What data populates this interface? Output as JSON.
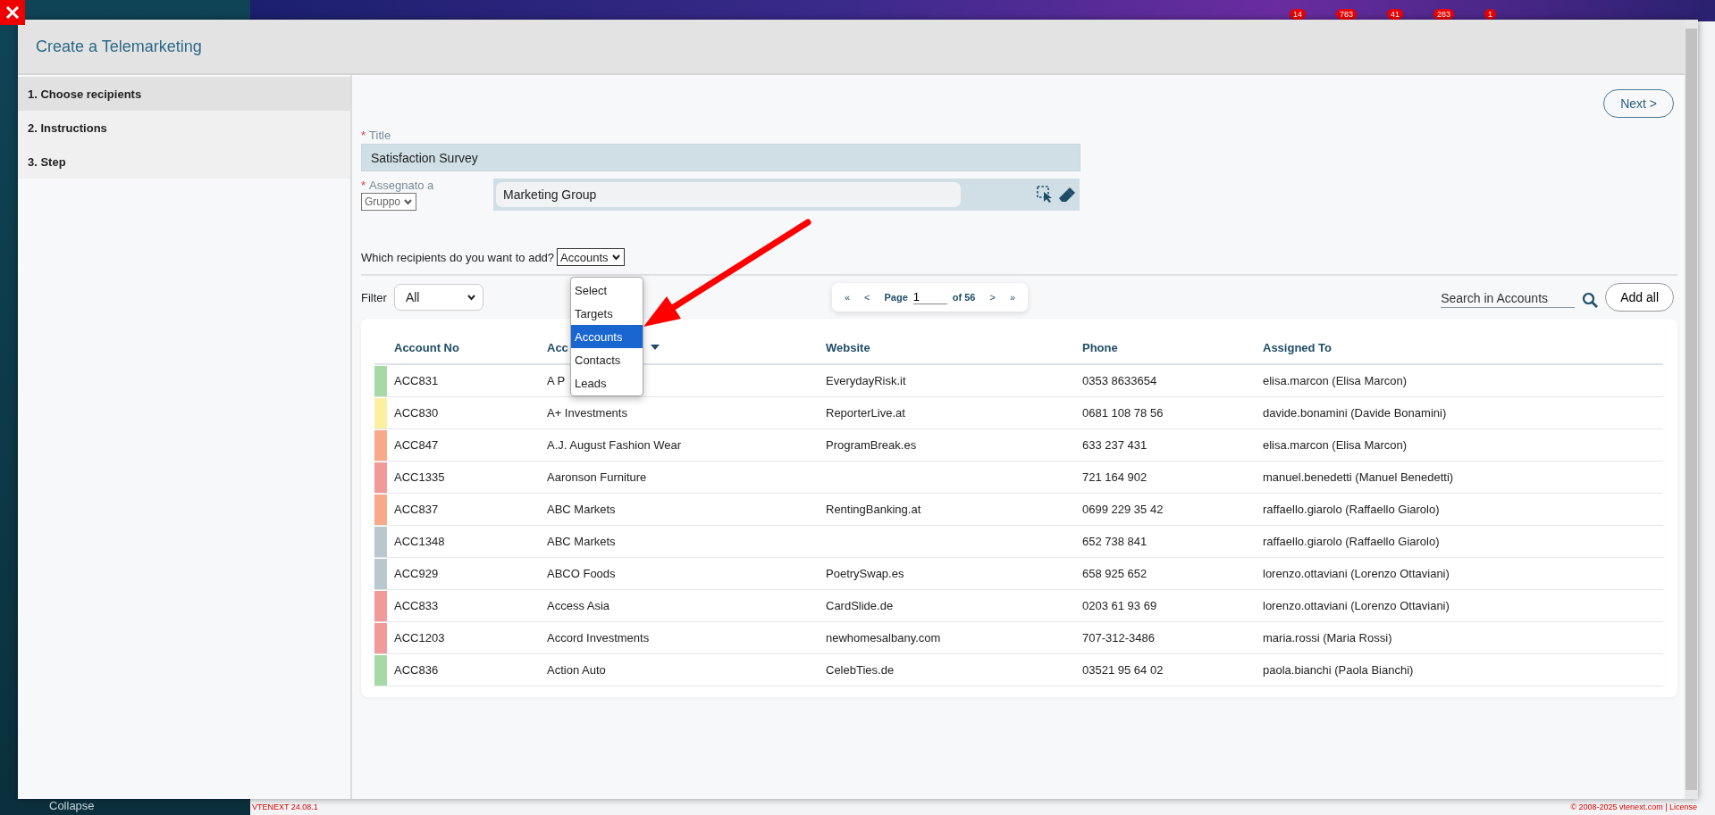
{
  "background_app": {
    "notification_badges": [
      "14",
      "783",
      "41",
      "283",
      "1"
    ],
    "collapse_label": "Collapse",
    "version": "VTENEXT 24.08.1",
    "copyright": "© 2008-2025 vtenext.com | License"
  },
  "window": {
    "title": "Create a Telemarketing"
  },
  "steps": [
    {
      "label": "1. Choose recipients",
      "selected": true
    },
    {
      "label": "2. Instructions",
      "selected": false
    },
    {
      "label": "3. Step",
      "selected": false
    }
  ],
  "next_button": "Next >",
  "form": {
    "title": {
      "required_mark": "*",
      "label": "Title",
      "value": "Satisfaction Survey"
    },
    "assigned_to": {
      "required_mark": "*",
      "label": "Assegnato a",
      "type_select": "Gruppo",
      "value": "Marketing Group"
    }
  },
  "recipients": {
    "question": "Which recipients do you want to add?",
    "value": "Accounts",
    "options": [
      {
        "label": "Select",
        "selected": false
      },
      {
        "label": "Targets",
        "selected": false
      },
      {
        "label": "Accounts",
        "selected": true
      },
      {
        "label": "Contacts",
        "selected": false
      },
      {
        "label": "Leads",
        "selected": false
      }
    ]
  },
  "filter": {
    "label": "Filter",
    "value": "All"
  },
  "pagination": {
    "first": "«",
    "prev": "<",
    "page_label": "Page",
    "page": "1",
    "of": "of 56",
    "next": ">",
    "last": "»"
  },
  "search": {
    "placeholder": "Search in Accounts"
  },
  "add_all_button": "Add all",
  "table": {
    "columns": [
      {
        "label": "Account No",
        "sorted": false
      },
      {
        "label": "Acc",
        "sorted": true
      },
      {
        "label": "Website",
        "sorted": false
      },
      {
        "label": "Phone",
        "sorted": false
      },
      {
        "label": "Assigned To",
        "sorted": false
      }
    ],
    "rows": [
      {
        "color": "#a6d9a6",
        "account_no": "ACC831",
        "account_name": "A P",
        "website": "EverydayRisk.it",
        "phone": "0353 8633654",
        "assigned_to": "elisa.marcon (Elisa Marcon)"
      },
      {
        "color": "#fbf0a0",
        "account_no": "ACC830",
        "account_name": "A+ Investments",
        "website": "ReporterLive.at",
        "phone": "0681 108 78 56",
        "assigned_to": "davide.bonamini (Davide Bonamini)"
      },
      {
        "color": "#f8a98a",
        "account_no": "ACC847",
        "account_name": "A.J. August Fashion Wear",
        "website": "ProgramBreak.es",
        "phone": "633 237 431",
        "assigned_to": "elisa.marcon (Elisa Marcon)"
      },
      {
        "color": "#f09a9a",
        "account_no": "ACC1335",
        "account_name": "Aaronson Furniture",
        "phone": "721 164 902",
        "assigned_to": "manuel.benedetti (Manuel Benedetti)"
      },
      {
        "color": "#f8a98a",
        "account_no": "ACC837",
        "account_name": "ABC Markets",
        "website": "RentingBanking.at",
        "phone": "0699 229 35 42",
        "assigned_to": "raffaello.giarolo (Raffaello Giarolo)"
      },
      {
        "color": "#b9c7ce",
        "account_no": "ACC1348",
        "account_name": "ABC Markets",
        "phone": "652 738 841",
        "assigned_to": "raffaello.giarolo (Raffaello Giarolo)"
      },
      {
        "color": "#b9c7ce",
        "account_no": "ACC929",
        "account_name": "ABCO Foods",
        "website": "PoetrySwap.es",
        "phone": "658 925 652",
        "assigned_to": "lorenzo.ottaviani (Lorenzo Ottaviani)"
      },
      {
        "color": "#f09a9a",
        "account_no": "ACC833",
        "account_name": "Access Asia",
        "website": "CardSlide.de",
        "phone": "0203 61 93 69",
        "assigned_to": "lorenzo.ottaviani (Lorenzo Ottaviani)"
      },
      {
        "color": "#f09a9a",
        "account_no": "ACC1203",
        "account_name": "Accord Investments",
        "website": "newhomesalbany.com",
        "phone": "707-312-3486",
        "assigned_to": "maria.rossi (Maria Rossi)"
      },
      {
        "color": "#a6d9a6",
        "account_no": "ACC836",
        "account_name": "Action Auto",
        "website": "CelebTies.de",
        "phone": "03521 95 64 02",
        "assigned_to": "paola.bianchi (Paola Bianchi)"
      }
    ]
  }
}
